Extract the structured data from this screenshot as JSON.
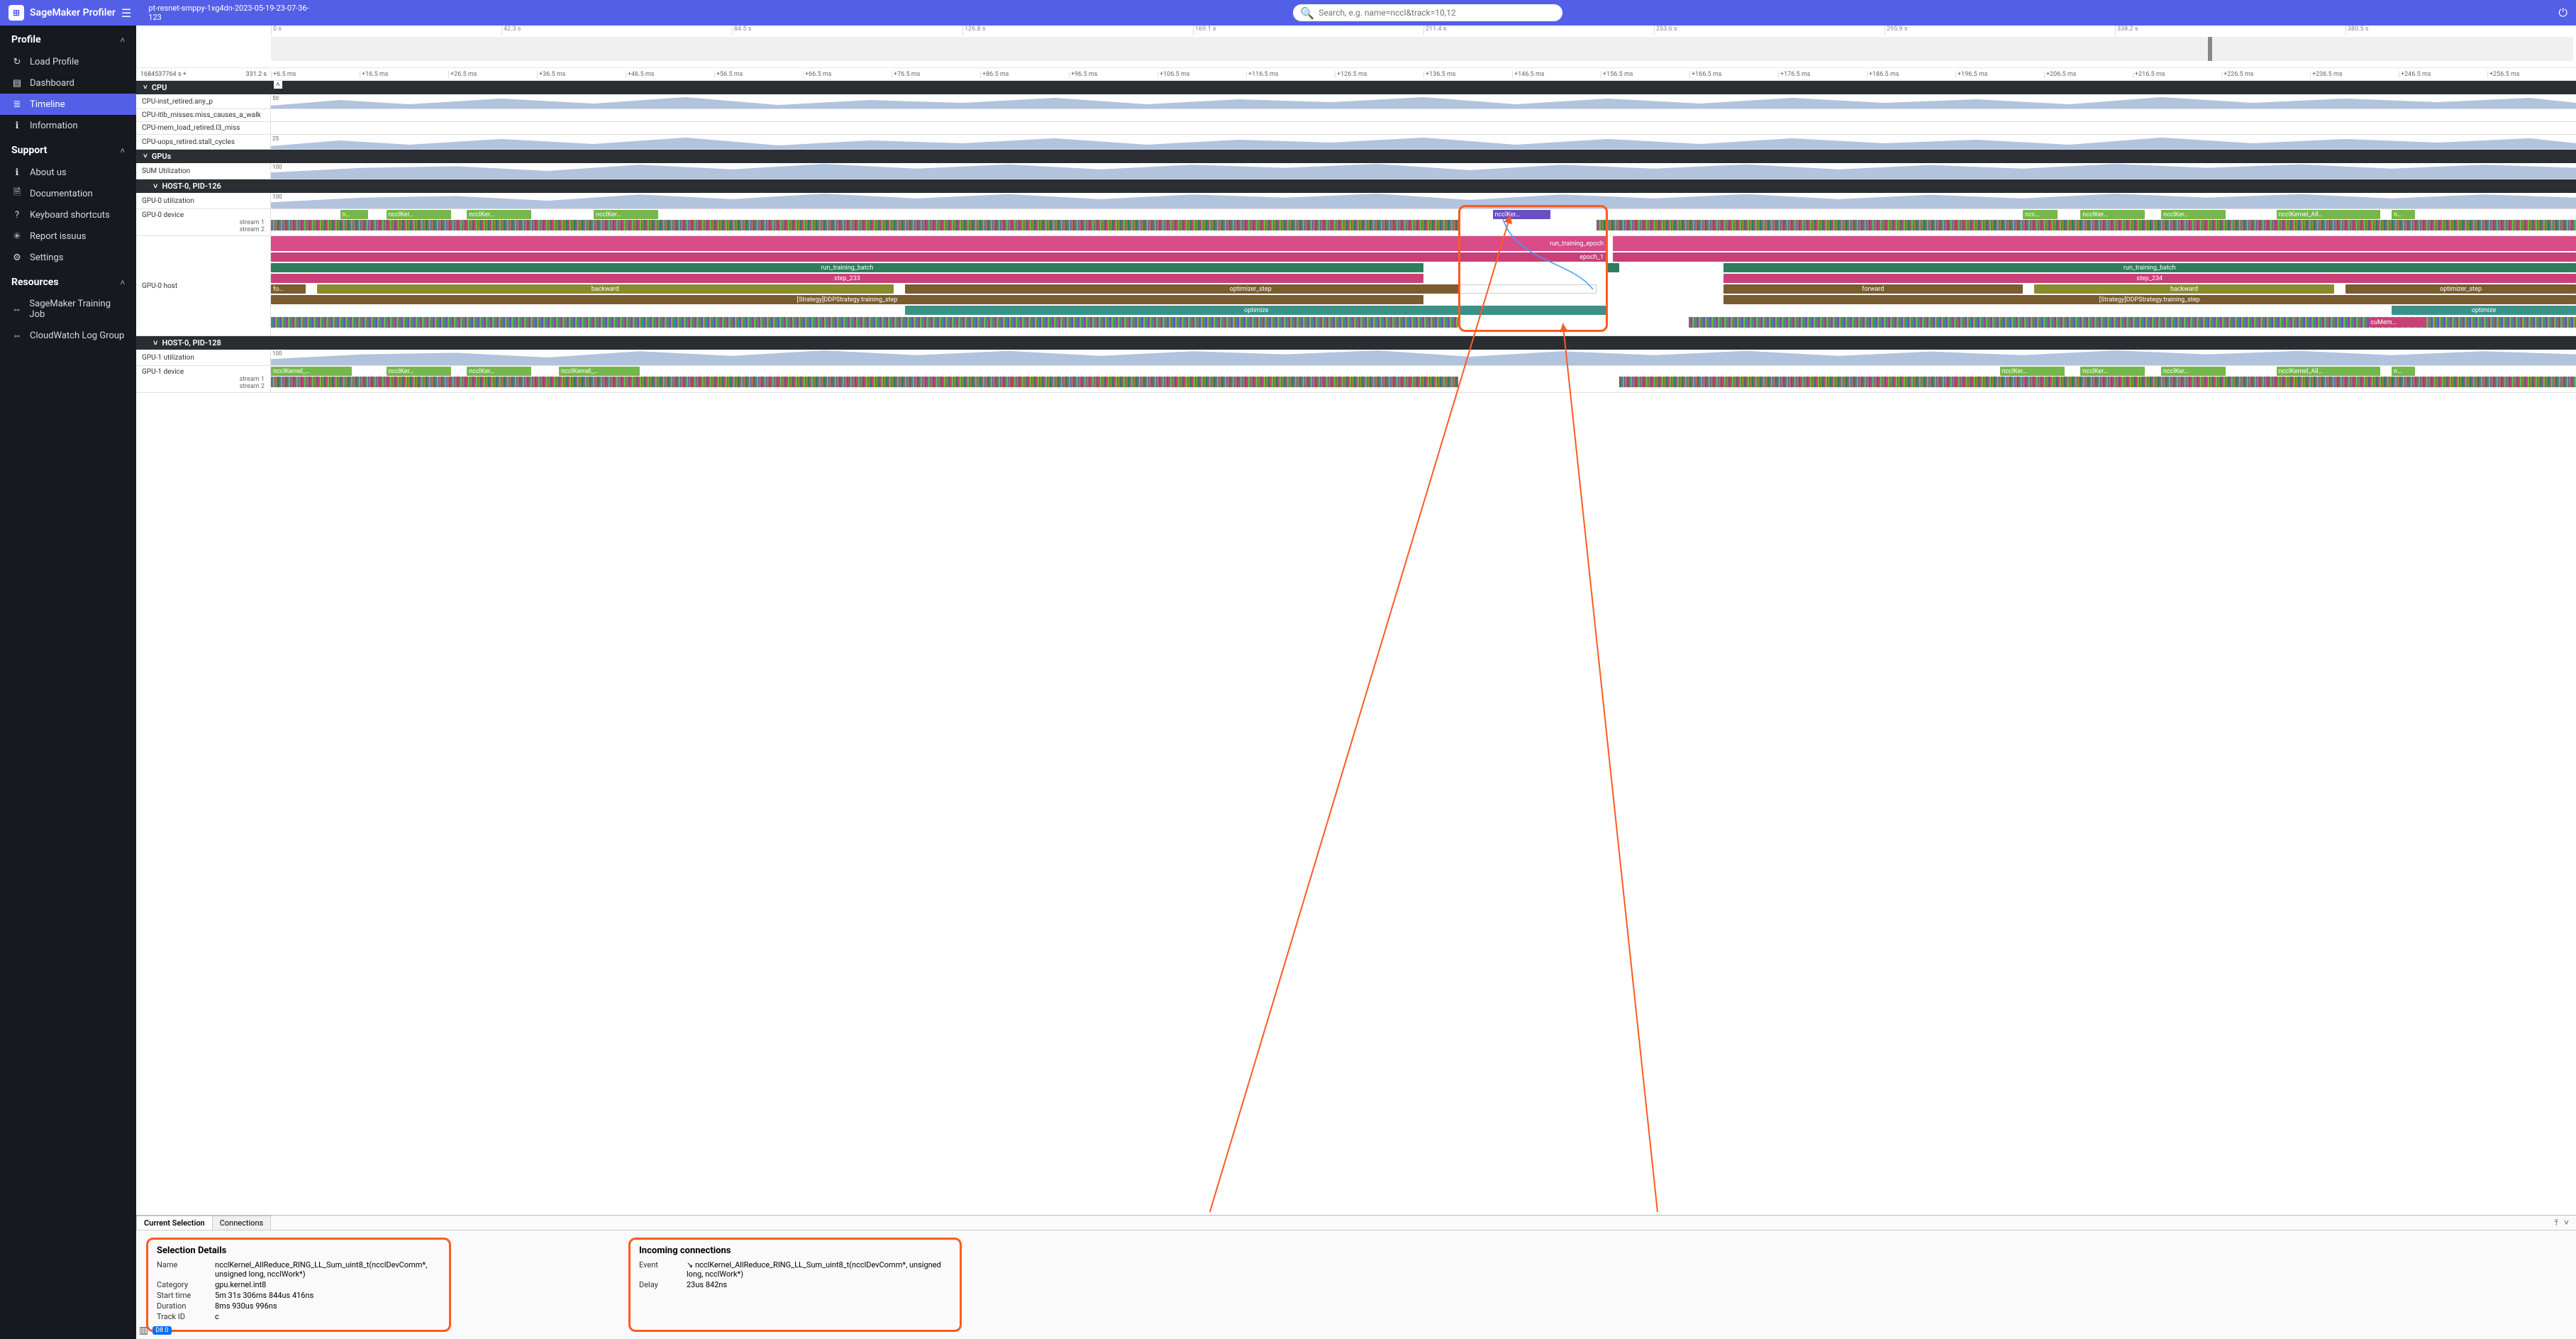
{
  "app": {
    "name": "SageMaker Profiler",
    "job": "pt-resnet-smppy-1xg4dn-2023-05-19-23-07-36-123"
  },
  "search": {
    "placeholder": "Search, e.g. name=nccl&track=10,12"
  },
  "sidebar": {
    "sections": [
      {
        "title": "Profile",
        "items": [
          {
            "label": "Load Profile",
            "icon": "↻"
          },
          {
            "label": "Dashboard",
            "icon": "▤"
          },
          {
            "label": "Timeline",
            "icon": "≣",
            "active": true
          },
          {
            "label": "Information",
            "icon": "ℹ"
          }
        ]
      },
      {
        "title": "Support",
        "items": [
          {
            "label": "About us",
            "icon": "ℹ"
          },
          {
            "label": "Documentation",
            "icon": "🗎"
          },
          {
            "label": "Keyboard shortcuts",
            "icon": "?"
          },
          {
            "label": "Report issuus",
            "icon": "✳"
          },
          {
            "label": "Settings",
            "icon": "⚙"
          }
        ]
      },
      {
        "title": "Resources",
        "items": [
          {
            "label": "SageMaker Training Job",
            "icon": "⇔"
          },
          {
            "label": "CloudWatch Log Group",
            "icon": "⇔"
          }
        ]
      }
    ]
  },
  "overview": {
    "ticks_s": [
      "0 s",
      "42.3 s",
      "84.5 s",
      "126.8 s",
      "169.1 s",
      "211.4 s",
      "253.6 s",
      "295.9 s",
      "338.2 s",
      "380.5 s"
    ],
    "base_time": "1684537764 s +",
    "span": "331.2 s",
    "ticks_ms": [
      "+6.5 ms",
      "+16.5 ms",
      "+26.5 ms",
      "+36.5 ms",
      "+46.5 ms",
      "+56.5 ms",
      "+66.5 ms",
      "+76.5 ms",
      "+86.5 ms",
      "+96.5 ms",
      "+106.5 ms",
      "+116.5 ms",
      "+126.5 ms",
      "+136.5 ms",
      "+146.5 ms",
      "+156.5 ms",
      "+166.5 ms",
      "+176.5 ms",
      "+186.5 ms",
      "+196.5 ms",
      "+206.5 ms",
      "+216.5 ms",
      "+226.5 ms",
      "+236.5 ms",
      "+246.5 ms",
      "+256.5 ms"
    ]
  },
  "groups": {
    "cpu": {
      "title": "CPU",
      "rows": [
        {
          "label": "CPU-inst_retired.any_p",
          "y": "50"
        },
        {
          "label": "CPU-itlb_misses.miss_causes_a_walk"
        },
        {
          "label": "CPU-mem_load_retired.l3_miss"
        },
        {
          "label": "CPU-uops_retired.stall_cycles",
          "y": "25"
        }
      ]
    },
    "gpus": {
      "title": "GPUs",
      "row": {
        "label": "SUM Utilization",
        "y": "100"
      }
    },
    "host0": {
      "title": "HOST-0, PID-126",
      "util": {
        "label": "GPU-0 utilization",
        "y": "100"
      },
      "device": {
        "label": "GPU-0 device",
        "streams": [
          "stream 1",
          "stream 2"
        ]
      },
      "host": {
        "label": "GPU-0 host"
      },
      "labels": {
        "run_training_epoch": "run_training_epoch",
        "epoch_1": "epoch_1",
        "run_training_batch_l": "run_training_batch",
        "run_training_batch_r": "run_training_batch",
        "step_233": "step_233",
        "step_234": "step_234",
        "forward_l": "fo…",
        "backward_l": "backward",
        "optimizer_step_l": "optimizer_step",
        "forward_r": "forward",
        "backward_r": "backward",
        "optimizer_step_r": "optimizer_step",
        "strategy_l": "[Strategy]DDPStrategy.training_step",
        "strategy_r": "[Strategy]DDPStrategy.training_step",
        "optimize_l": "optimize",
        "optimize_r": "optimize",
        "cuMem": "cuMem…",
        "ncclKer": "ncclKer…",
        "ncclKernel_All": "ncclKernel_All…",
        "n": "n…",
        "ncc": "ncc…"
      }
    },
    "host1": {
      "title": "HOST-0, PID-128",
      "util": {
        "label": "GPU-1 utilization",
        "y": "100"
      },
      "device": {
        "label": "GPU-1 device",
        "streams": [
          "stream 1",
          "stream 2"
        ]
      },
      "labels": {
        "ncclKernel_": "ncclKernel_…",
        "ncclKer": "ncclKer…",
        "ncclKernel_All": "ncclKernel_All…",
        "n": "n…"
      }
    }
  },
  "bottom": {
    "tabs": [
      "Current Selection",
      "Connections"
    ],
    "selection": {
      "title": "Selection Details",
      "rows": {
        "Name": "ncclKernel_AllReduce_RING_LL_Sum_uint8_t(ncclDevComm*, unsigned long, ncclWork*)",
        "Category": "gpu.kernel.int8",
        "Start time": "5m 31s 306ms 844us 416ns",
        "Duration": "8ms 930us 996ns",
        "Track ID": "c"
      }
    },
    "connections": {
      "title": "Incoming connections",
      "rows": {
        "Event": "↘ ncclKernel_AllReduce_RING_LL_Sum_uint8_t(ncclDevComm*, unsigned long, ncclWork*)",
        "Delay": "23us 842ns"
      }
    }
  },
  "footer": {
    "badge": "D8 0"
  }
}
